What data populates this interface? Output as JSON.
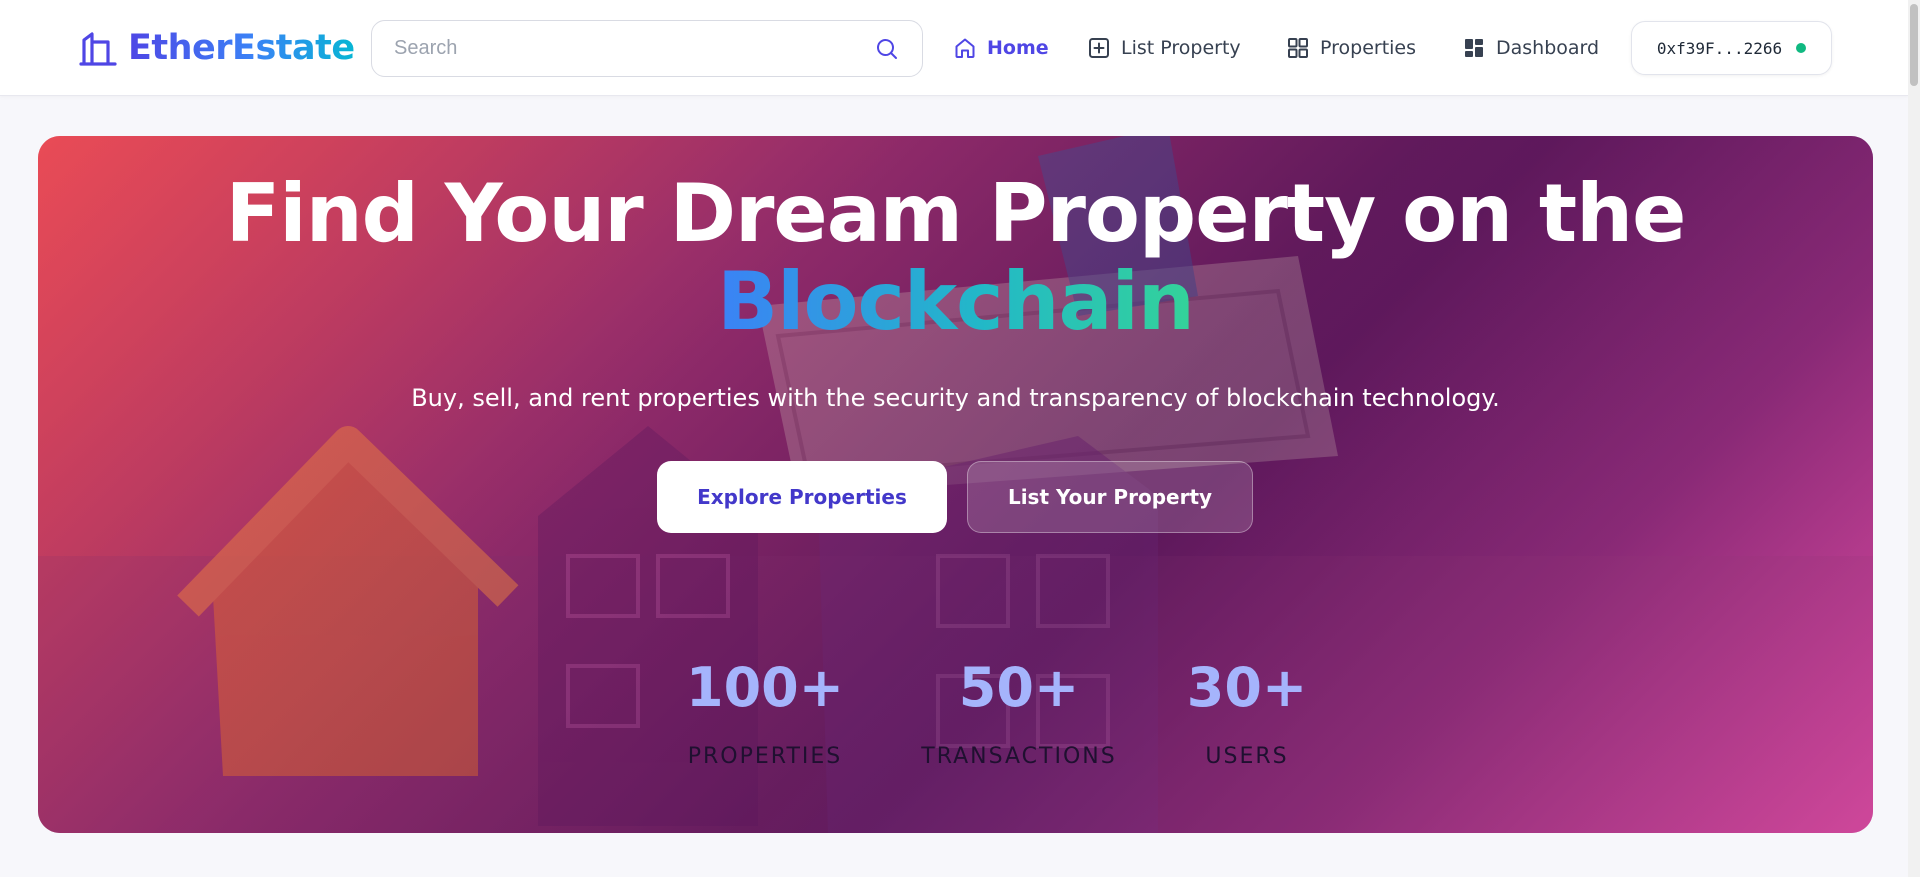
{
  "header": {
    "brand": "EtherEstate",
    "search_placeholder": "Search",
    "nav": [
      {
        "label": "Home",
        "icon": "home-icon",
        "active": true
      },
      {
        "label": "List Property",
        "icon": "plus-square-icon",
        "active": false
      },
      {
        "label": "Properties",
        "icon": "grid-icon",
        "active": false
      },
      {
        "label": "Dashboard",
        "icon": "dashboard-icon",
        "active": false
      }
    ],
    "wallet": {
      "address": "0xf39F...2266",
      "status_color": "#10b981"
    }
  },
  "hero": {
    "title_line1": "Find Your Dream Property on the",
    "title_line2": "Blockchain",
    "subtitle": "Buy, sell, and rent properties with the security and transparency of blockchain technology.",
    "primary_button": "Explore Properties",
    "secondary_button": "List Your Property",
    "stats": [
      {
        "value": "100+",
        "label": "PROPERTIES"
      },
      {
        "value": "50+",
        "label": "TRANSACTIONS"
      },
      {
        "value": "30+",
        "label": "USERS"
      }
    ]
  },
  "colors": {
    "accent": "#4f46e5",
    "brand_gradient_end": "#06b6d4",
    "stat_value": "#a5b4fc"
  }
}
